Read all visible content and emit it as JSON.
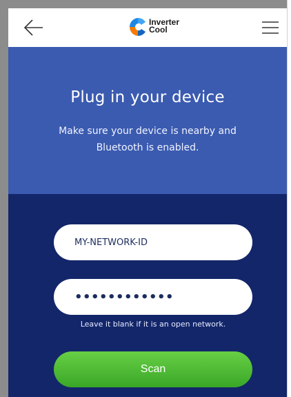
{
  "header": {
    "back_icon": "arrow-left-icon",
    "logo_line1": "Inverter",
    "logo_line2": "Cool",
    "menu_icon": "hamburger-menu-icon"
  },
  "hero": {
    "title": "Plug in your device",
    "subtitle": "Make sure your device is nearby and Bluetooth is enabled."
  },
  "form": {
    "network_value": "MY-NETWORK-ID",
    "password_value": "••••••••••••",
    "hint": "Leave it blank if it is an open network.",
    "scan_label": "Scan"
  },
  "colors": {
    "hero_bg": "#3b5bb0",
    "form_bg": "#13266a",
    "scan_button": "#4dbb34",
    "logo_blue": "#1e88e5",
    "logo_orange": "#f57c00"
  }
}
